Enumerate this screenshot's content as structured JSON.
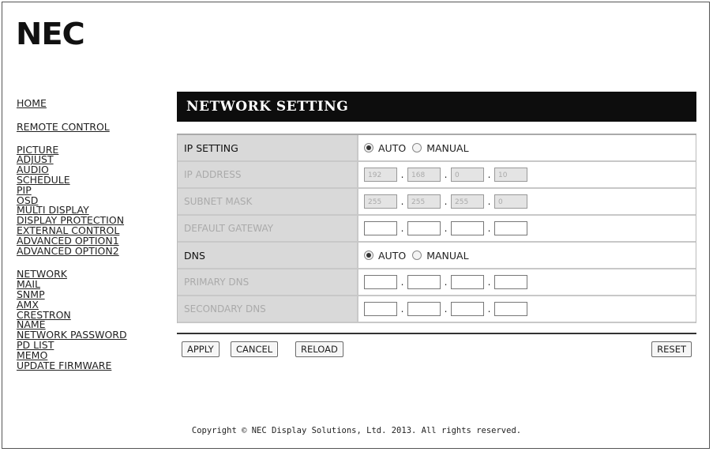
{
  "brand": {
    "logo_text": "NEC"
  },
  "nav": {
    "group1": [
      "HOME",
      "REMOTE CONTROL"
    ],
    "group2": [
      "PICTURE",
      "ADJUST",
      "AUDIO",
      "SCHEDULE",
      "PIP",
      "OSD",
      "MULTI DISPLAY",
      "DISPLAY PROTECTION",
      "EXTERNAL CONTROL",
      "ADVANCED OPTION1",
      "ADVANCED OPTION2"
    ],
    "group3": [
      "NETWORK",
      "MAIL",
      "SNMP",
      "AMX",
      "CRESTRON",
      "NAME",
      "NETWORK PASSWORD",
      "PD LIST",
      "MEMO",
      "UPDATE FIRMWARE"
    ]
  },
  "page": {
    "title": "NETWORK SETTING"
  },
  "rows": {
    "ip_setting": {
      "label": "IP SETTING",
      "auto": "AUTO",
      "manual": "MANUAL",
      "selected": "AUTO"
    },
    "ip_address": {
      "label": "IP ADDRESS",
      "octets": [
        "192",
        "168",
        "0",
        "10"
      ]
    },
    "subnet_mask": {
      "label": "SUBNET MASK",
      "octets": [
        "255",
        "255",
        "255",
        "0"
      ]
    },
    "default_gateway": {
      "label": "DEFAULT GATEWAY",
      "octets": [
        "",
        "",
        "",
        ""
      ]
    },
    "dns": {
      "label": "DNS",
      "auto": "AUTO",
      "manual": "MANUAL",
      "selected": "AUTO"
    },
    "primary_dns": {
      "label": "PRIMARY DNS",
      "octets": [
        "",
        "",
        "",
        ""
      ]
    },
    "secondary_dns": {
      "label": "SECONDARY DNS",
      "octets": [
        "",
        "",
        "",
        ""
      ]
    }
  },
  "separator": ".",
  "buttons": {
    "apply": "APPLY",
    "cancel": "CANCEL",
    "reload": "RELOAD",
    "reset": "RESET"
  },
  "footer": {
    "copyright": "Copyright © NEC Display Solutions, Ltd. 2013. All rights reserved."
  }
}
